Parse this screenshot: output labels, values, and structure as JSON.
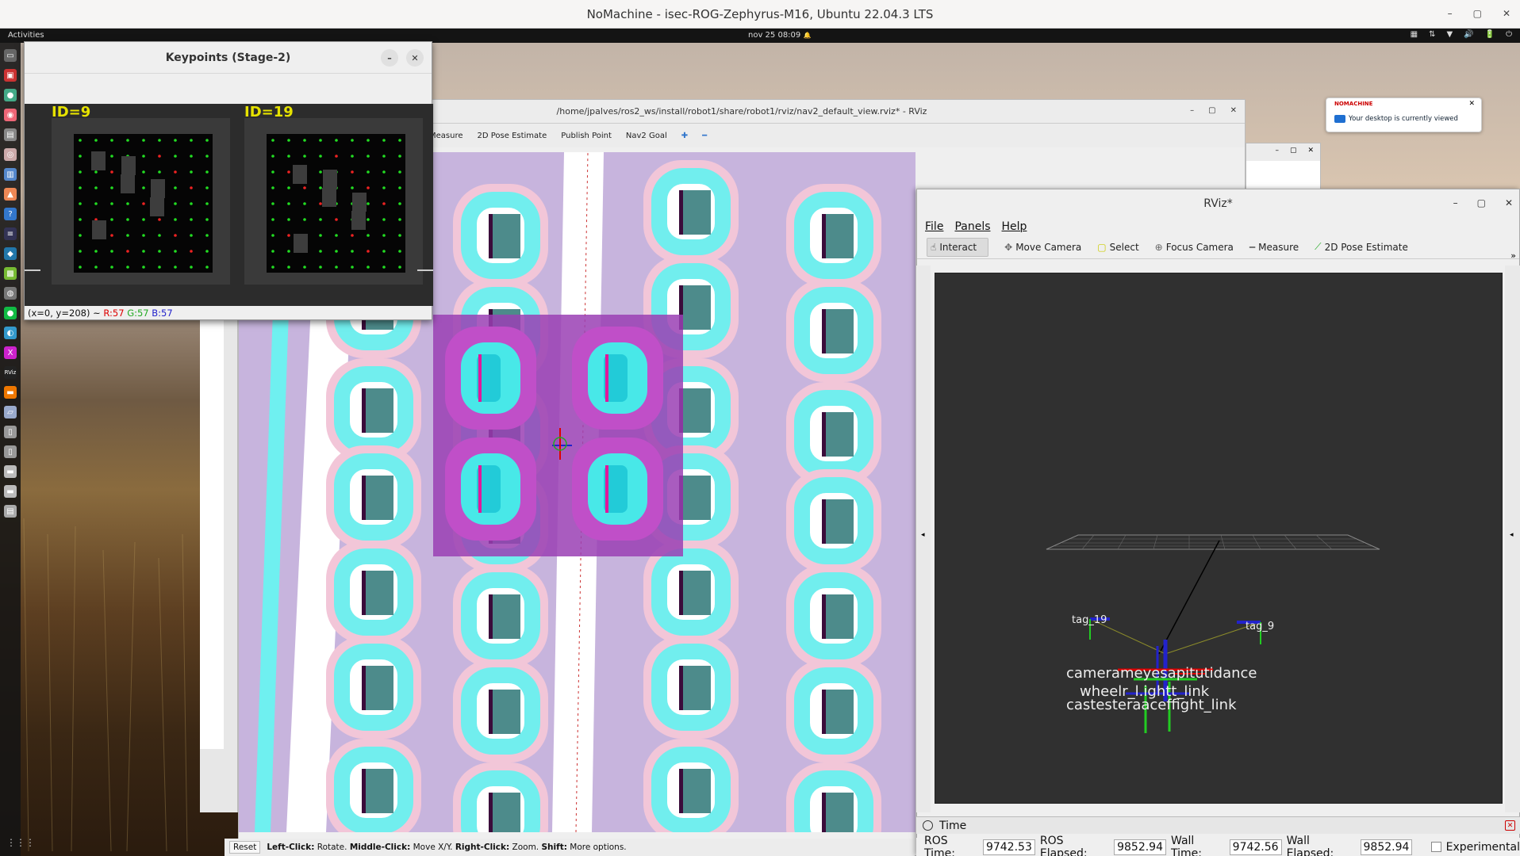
{
  "nomachine": {
    "title": "NoMachine - isec-ROG-Zephyrus-M16, Ubuntu 22.04.3 LTS",
    "min": "–",
    "max": "▢",
    "close": "✕",
    "notif_logo": "NOMACHINE",
    "notif_msg": "Your desktop is currently viewed",
    "notif_close": "✕"
  },
  "gnome": {
    "activities": "Activities",
    "clock": "nov 25  08:09",
    "bell": "🔔",
    "tray": [
      "▦",
      "⇅",
      "▼",
      "🔊",
      "🔋",
      "⏻"
    ]
  },
  "dock": [
    "▭",
    "▣",
    "●",
    "◉",
    "▤",
    "◎",
    "▥",
    "▲",
    "?",
    "≡",
    "◆",
    "▩",
    "◍",
    "●",
    "◐",
    "X",
    "RViz",
    "▬",
    "▱",
    "▯",
    "▯",
    "▬",
    "▬",
    "▤"
  ],
  "dock_grid": "⋮⋮⋮",
  "keypoints": {
    "title": "Keypoints (Stage-2)",
    "min": "–",
    "close": "✕",
    "id_left": "ID=9",
    "id_right": "ID=19",
    "pixel_prefix": "(x=0, y=208) ~ ",
    "r": "R:57",
    "g": "G:57",
    "b": "B:57"
  },
  "rviz_main": {
    "title": "/home/jpalves/ros2_ws/install/robot1/share/robot1/rviz/nav2_default_view.rviz* - RViz",
    "min": "–",
    "max": "▢",
    "close": "✕",
    "tools": [
      "Measure",
      "2D Pose Estimate",
      "Publish Point",
      "Nav2 Goal",
      "✚",
      "━"
    ],
    "status_reset": "Reset",
    "status_parts": [
      {
        "b": "Left-Click:",
        "t": " Rotate. "
      },
      {
        "b": "Middle-Click:",
        "t": " Move X/Y. "
      },
      {
        "b": "Right-Click:",
        "t": " Zoom. "
      },
      {
        "b": "Shift:",
        "t": " More options."
      }
    ]
  },
  "small_window": {
    "min": "–",
    "max": "▢",
    "close": "✕"
  },
  "rviz_front": {
    "title": "RViz*",
    "min": "–",
    "max": "▢",
    "close": "✕",
    "menu": [
      "File",
      "Panels",
      "Help"
    ],
    "tools": [
      "Interact",
      "Move Camera",
      "Select",
      "Focus Camera",
      "Measure",
      "2D Pose Estimate"
    ],
    "more": "»",
    "labels": {
      "tag19": "tag_19",
      "tag9": "tag_9",
      "l1": "camerameyesapitutidance",
      "l2": "wheelr_l.ightt_link",
      "l3": "castesteraaceffight_link"
    },
    "time_title": "Time",
    "time_close": "✕",
    "ros_time_label": "ROS Time:",
    "ros_time": "9742.53",
    "ros_elapsed_label": "ROS Elapsed:",
    "ros_elapsed": "9852.94",
    "wall_time_label": "Wall Time:",
    "wall_time": "9742.56",
    "wall_elapsed_label": "Wall Elapsed:",
    "wall_elapsed": "9852.94",
    "experimental": "Experimental"
  }
}
